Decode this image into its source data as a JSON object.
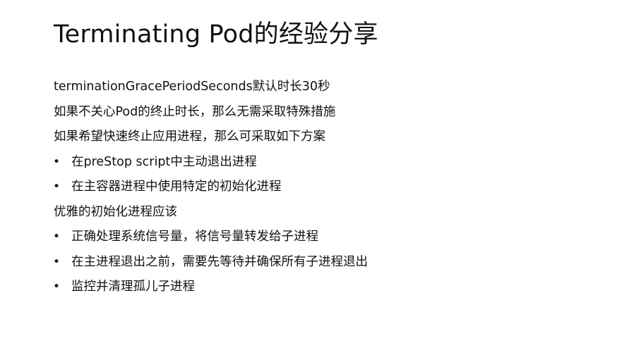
{
  "title": "Terminating Pod的经验分享",
  "lines": [
    {
      "text": "terminationGracePeriodSeconds默认时长30秒",
      "bullet": false
    },
    {
      "text": "如果不关心Pod的终止时长，那么无需采取特殊措施",
      "bullet": false
    },
    {
      "text": "如果希望快速终止应用进程，那么可采取如下方案",
      "bullet": false
    },
    {
      "text": "在preStop script中主动退出进程",
      "bullet": true
    },
    {
      "text": "在主容器进程中使用特定的初始化进程",
      "bullet": true
    },
    {
      "text": "优雅的初始化进程应该",
      "bullet": false
    },
    {
      "text": "正确处理系统信号量，将信号量转发给子进程",
      "bullet": true
    },
    {
      "text": "在主进程退出之前，需要先等待并确保所有子进程退出",
      "bullet": true
    },
    {
      "text": "监控并清理孤儿子进程",
      "bullet": true
    }
  ],
  "bullet_symbol": "•"
}
